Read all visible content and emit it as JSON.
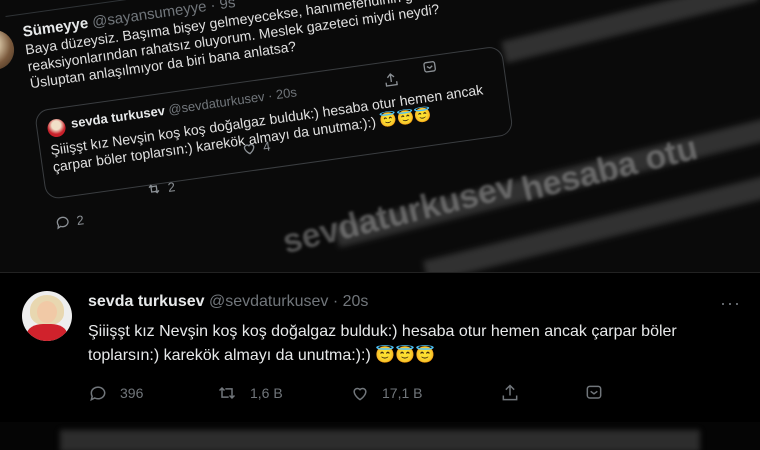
{
  "top": {
    "top_handle": "@...",
    "reply": {
      "name": "Sümeyye",
      "handle": "@sayansumeyye",
      "time": "9s",
      "text": "Baya düzeysiz. Başıma bişey gelmeyecekse, hanımefendinin genel tepki reaksiyonlarından rahatsız oluyorum. Meslek gazeteci miydi neydi? Üsluptan anlaşılmıyor da biri bana anlatsa?"
    },
    "quote": {
      "name": "sevda turkusev",
      "handle": "@sevdaturkusev",
      "time": "20s",
      "text": "Şiiişşt kız Nevşin koş koş doğalgaz bulduk:) hesaba otur hemen ancak çarpar böler toplarsın:) karekök almayı da unutma:):)",
      "emojis": "😇😇😇"
    },
    "counts": {
      "like": "4",
      "retweet": "2",
      "reply": "2"
    },
    "bg_text": [
      "sevdaturkusev",
      "hesaba otu"
    ]
  },
  "tweet": {
    "name": "sevda turkusev",
    "handle": "@sevdaturkusev",
    "sep": "·",
    "time": "20s",
    "text": "Şiiişşt kız Nevşin koş koş doğalgaz bulduk:) hesaba otur hemen ancak çarpar böler toplarsın:) karekök almayı da unutma:):)",
    "emojis": "😇😇😇",
    "more": "···",
    "reply_count": "396",
    "retweet_count": "1,6 B",
    "like_count": "17,1 B"
  },
  "colors": {
    "background": "#000000",
    "muted": "#71767b",
    "text": "#e7e9ea",
    "emoji": "#f5c542"
  }
}
